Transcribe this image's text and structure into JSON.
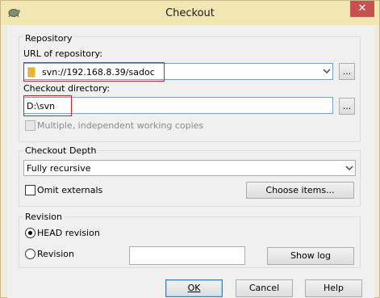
{
  "window": {
    "title": "Checkout"
  },
  "repository": {
    "group_label": "Repository",
    "url_label": "URL of repository:",
    "url_value": "svn://192.168.8.39/sadoc",
    "dir_label": "Checkout directory:",
    "dir_value": "D:\\svn",
    "browse_label": "...",
    "multiple_label": "Multiple, independent working copies"
  },
  "depth": {
    "group_label": "Checkout Depth",
    "selected": "Fully recursive",
    "omit_label": "Omit externals",
    "choose_label": "Choose items..."
  },
  "revision": {
    "group_label": "Revision",
    "head_label": "HEAD revision",
    "revision_label": "Revision",
    "revision_value": "",
    "showlog_label": "Show log"
  },
  "buttons": {
    "ok": "OK",
    "cancel": "Cancel",
    "help": "Help"
  },
  "colors": {
    "title_bar": "#f2e7b3",
    "highlight_box": "#e01e1e",
    "close_button": "#c75050"
  }
}
